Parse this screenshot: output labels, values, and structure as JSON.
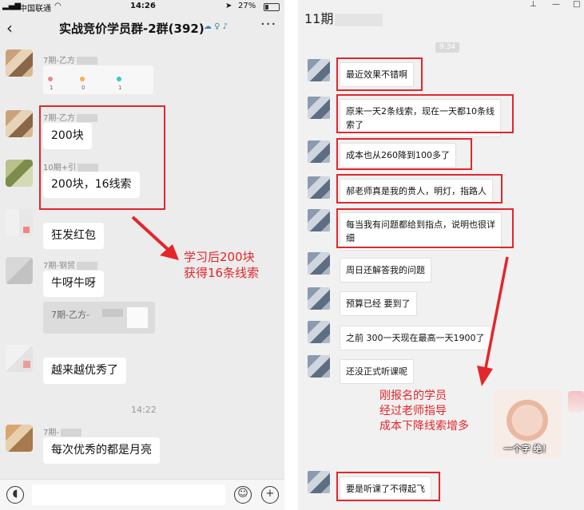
{
  "left": {
    "status": {
      "carrier": "中国联通",
      "time": "14:26",
      "battery": "27%"
    },
    "nav": {
      "title": "实战竞价学员群-2群(392)",
      "more": "···"
    },
    "messages": [
      {
        "sender": "7期-乙方",
        "card": {
          "labels": [
            "1",
            "0",
            "1"
          ]
        }
      },
      {
        "sender": "7期-乙方",
        "text": "200块"
      },
      {
        "sender": "10期+引",
        "text": "200块，16线索"
      },
      {
        "text": "狂发红包"
      },
      {
        "sender": "7期-钢贸",
        "text": "牛呀牛呀",
        "quote": "7期-乙方-"
      },
      {
        "text": "越来越优秀了"
      },
      {
        "timestamp": "14:22"
      },
      {
        "sender": "7期-",
        "text": "每次优秀的都是月亮"
      }
    ],
    "annotation": [
      "学习后200块",
      "获得16条线索"
    ]
  },
  "right": {
    "title": "11期",
    "time": "9:34",
    "messages": [
      "最近效果不错啊",
      "原来一天2条线索，现在一天都10条线\n索了",
      "成本也从260降到100多了",
      "郝老师真是我的贵人，明灯，指路人",
      "每当我有问题都给到指点，说明也很详\n细",
      "周日还解答我的问题",
      "预算已经 要到了",
      "之前 300一天现在最高一天1900了",
      "还没正式听课呢",
      "要是听课了不得起飞"
    ],
    "annotation": [
      "刚报名的学员",
      "经过老师指导",
      "成本下降线索增多"
    ],
    "sticker_caption": "一个字 绝！"
  },
  "colors": {
    "highlight": "#e3262b"
  }
}
